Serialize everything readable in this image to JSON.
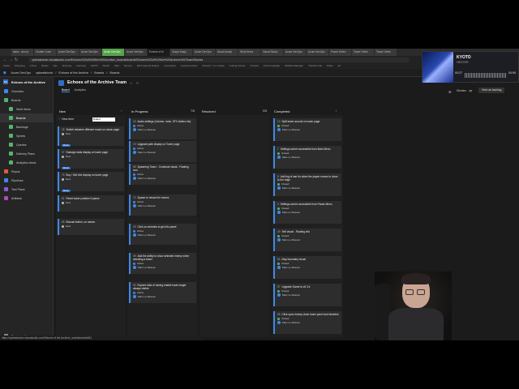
{
  "browser": {
    "tabs": [
      "tasks - dev-to",
      "Chatter Code",
      "Azure DevOps",
      "Azure DevOps",
      "Azure DevOps",
      "Azure DevOps",
      "Echoes of th",
      "Graph Analy",
      "Azure DevOps",
      "About Analyt",
      "Work Items",
      "Visual Studio",
      "Azure DevOps",
      "Azure DevOps",
      "Power Defen",
      "Tower Defen",
      "Tower Defen"
    ],
    "url": "xpbeatstonic.visualstudio.com/Echoes%20of%20the%20Archive/_boards/board/t/Echoes%20of%20the%20Archive%20Team/Stories",
    "bookmarks": [
      "Guide",
      "Shopping",
      "Anime",
      "Books",
      "Dev",
      "Running",
      "Learning",
      "GIFTS",
      "Studio",
      "Mail",
      "Servers",
      "Ebi's Gamed Engine",
      "Incomplete",
      "Learning Cyber",
      "Passion / 1.1 Create",
      "Coding Games",
      "Tutorial",
      "Get Knowledge",
      "Wishlist Manager",
      "Thinkful Link",
      "Pulse",
      "c#"
    ]
  },
  "ado": {
    "org": "Azure DevOps",
    "crumbs": [
      "xpbeatstonic",
      "/",
      "Echoes of the Archive",
      "/",
      "Boards",
      "/",
      "Boards"
    ]
  },
  "sidebar": {
    "project": "Echoes of the Archive",
    "project_initial": "EA",
    "items": [
      {
        "label": "Overview",
        "color": "#3d8ae8"
      },
      {
        "label": "Boards",
        "color": "#54b46c"
      },
      {
        "label": "Work items",
        "color": "#54b46c"
      },
      {
        "label": "Boards",
        "color": "#54b46c"
      },
      {
        "label": "Backlogs",
        "color": "#54b46c"
      },
      {
        "label": "Sprints",
        "color": "#54b46c"
      },
      {
        "label": "Queries",
        "color": "#54b46c"
      },
      {
        "label": "Delivery Plans",
        "color": "#54b46c"
      },
      {
        "label": "Analytics views",
        "color": "#54b46c"
      },
      {
        "label": "Repos",
        "color": "#e05a3a"
      },
      {
        "label": "Pipelines",
        "color": "#3d8ae8"
      },
      {
        "label": "Test Plans",
        "color": "#8a5bd6"
      },
      {
        "label": "Artifacts",
        "color": "#b04ab5"
      }
    ],
    "footer": "Project settings"
  },
  "board": {
    "team": "Echoes of the Archive Team",
    "tabs": [
      "Board",
      "Analytics"
    ],
    "backlog_level": "Stories",
    "view_button": "View as backlog",
    "filter_value": "Rolled"
  },
  "columns": [
    {
      "name": "New",
      "count": ""
    },
    {
      "name": "In Progress",
      "count": "7/5"
    },
    {
      "name": "Resolved",
      "count": "0/5"
    },
    {
      "name": "Completed",
      "count": ""
    }
  ],
  "new_item": "New item",
  "cards": {
    "new": [
      {
        "id": "36",
        "title": "Switch between different music on music page",
        "state": "New",
        "tag": "Music",
        "state_color": "#bbbbbb"
      },
      {
        "id": "37",
        "title": "Damage stats display on tower page",
        "state": "New",
        "tag": "Music",
        "state_color": "#bbbbbb"
      },
      {
        "id": "75",
        "title": "Buy / Sell tree display on tower page",
        "state": "New",
        "tag": "Music",
        "state_color": "#bbbbbb"
      },
      {
        "id": "61",
        "title": "Reset tower position if pause",
        "state": "New",
        "tag": "",
        "state_color": "#bbbbbb"
      },
      {
        "id": "65",
        "title": "Manual button, on waves",
        "state": "New",
        "tag": "",
        "state_color": "#bbbbbb"
      }
    ],
    "inprogress": [
      {
        "id": "18",
        "title": "Audio settings (Volume, mute, SFX sliders etc)",
        "state": "Active",
        "who": "Marc Le Masson"
      },
      {
        "id": "19",
        "title": "Upgrade path display on Tower page",
        "state": "Active",
        "who": "Marc Le Masson"
      },
      {
        "id": "58",
        "title": "Spawning Tower - Construct visual - Floating icon",
        "state": "Active",
        "who": "Marc Le Masson"
      },
      {
        "id": "70",
        "title": "Spawn to reward for towers",
        "state": "Active",
        "who": "Marc Le Masson"
      },
      {
        "id": "29",
        "title": "Click on enemies to get info panel",
        "state": "Active",
        "who": "Marc Le Masson"
      },
      {
        "id": "49",
        "title": "Add the ability to show selected enemy when selecting a tower",
        "state": "Active",
        "who": "Marc Le Masson"
      },
      {
        "id": "50",
        "title": "Explore idea of having enable tower target always visible",
        "state": "Active",
        "who": "Marc Le Masson"
      }
    ],
    "completed": [
      {
        "id": "13",
        "title": "Split tower around on tower page",
        "state": "Closed",
        "who": "Marc Le Masson"
      },
      {
        "id": "7",
        "title": "Settings screen accessible from Main Menu",
        "state": "Closed",
        "who": "Marc Le Masson"
      },
      {
        "id": "8",
        "title": "Add fog of war for when the player moves to close to the edge",
        "state": "Closed",
        "who": "Marc Le Masson"
      },
      {
        "id": "9",
        "title": "Settings screen accessible from Pause Menu",
        "state": "Closed",
        "who": "Marc Le Masson"
      },
      {
        "id": "49",
        "title": "Sell visual - Floating info",
        "state": "Closed",
        "who": "Marc Le Masson"
      },
      {
        "id": "54",
        "title": "Map boundary visual",
        "state": "Closed",
        "who": "Marc Le Masson"
      },
      {
        "id": "57",
        "title": "Upgrade Game to v6 3.4",
        "state": "Closed",
        "who": "Marc Le Masson"
      },
      {
        "id": "58",
        "title": "Click upon enemy close tower panel and deselect",
        "state": "Closed",
        "who": "Marc Le Masson"
      },
      {
        "id": "60",
        "title": "Improve Tower cloud visual effect",
        "state": "Closed",
        "who": "Marc Le Masson"
      }
    ]
  },
  "player": {
    "title": "KYOTO",
    "subtitle": "HESTER",
    "time_elapsed": "00:27",
    "time_total": "00:59"
  },
  "status_url": "https://xpbeatstonic.visualstudio.com/Echoes of the Archive/_workitems/edit/61"
}
